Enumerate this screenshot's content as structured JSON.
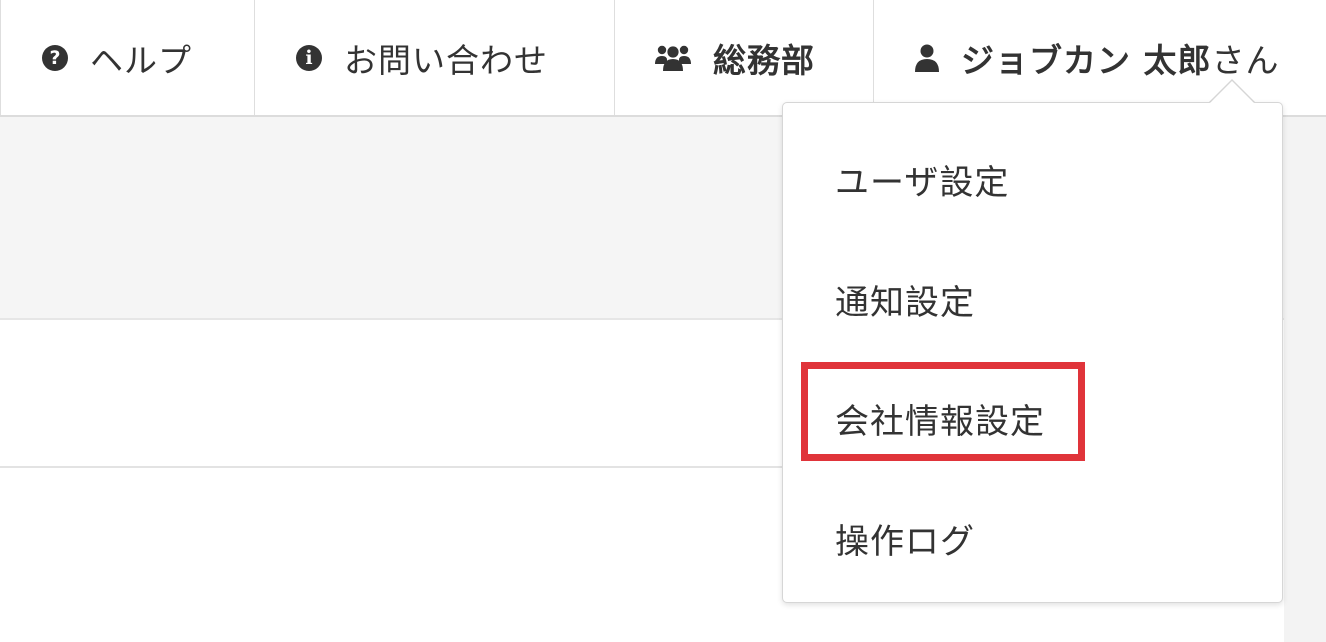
{
  "nav": {
    "help": {
      "icon": "question-circle-icon",
      "label": "ヘルプ"
    },
    "contact": {
      "icon": "info-circle-icon",
      "label": "お問い合わせ"
    },
    "department": {
      "icon": "users-icon",
      "label": "総務部"
    },
    "user": {
      "icon": "user-icon",
      "name": "ジョブカン 太郎",
      "suffix": "さん"
    }
  },
  "dropdown": {
    "items": [
      {
        "label": "ユーザ設定"
      },
      {
        "label": "通知設定"
      },
      {
        "label": "会社情報設定",
        "highlighted": true
      },
      {
        "label": "操作ログ"
      }
    ]
  },
  "colors": {
    "text": "#333333",
    "highlight": "#e0343a",
    "band": "#f5f5f5",
    "border": "#dcdcdc"
  }
}
